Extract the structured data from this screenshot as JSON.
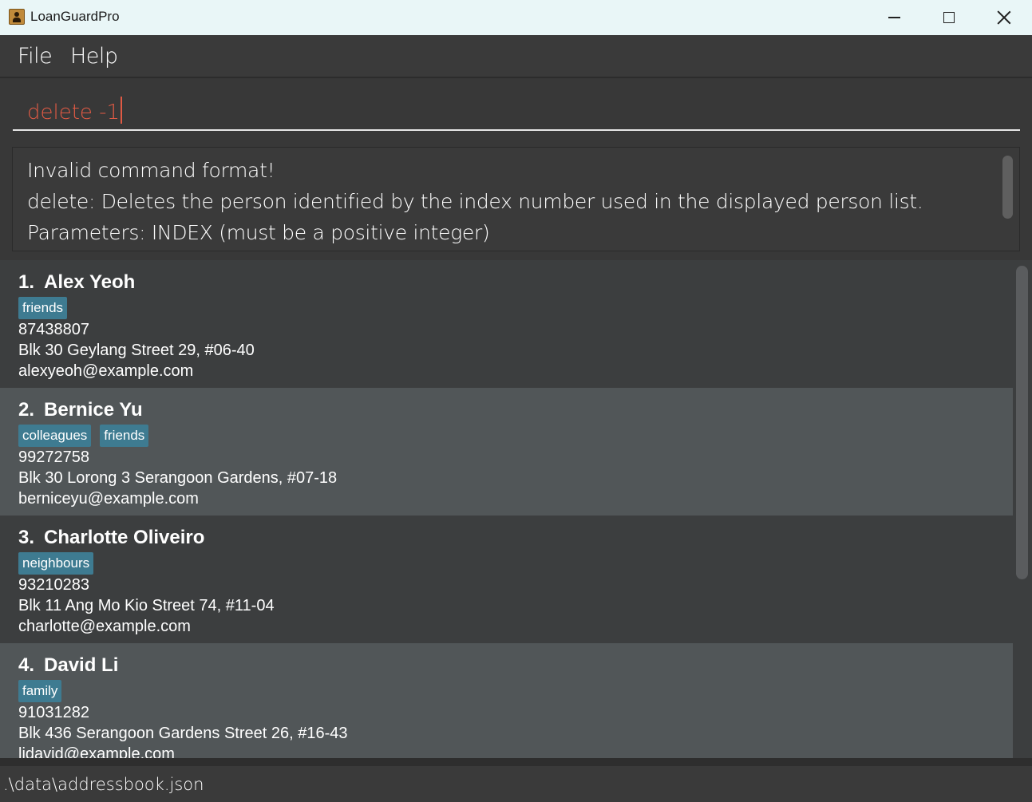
{
  "window": {
    "title": "LoanGuardPro",
    "icon": "contact-book-icon",
    "controls": [
      "minimize-icon",
      "maximize-icon",
      "close-icon"
    ]
  },
  "menu": {
    "items": [
      {
        "label": "File"
      },
      {
        "label": "Help"
      }
    ]
  },
  "command": {
    "value": "delete -1",
    "text_color": "#e05a44"
  },
  "result": {
    "lines": [
      "Invalid command format!",
      "delete: Deletes the person identified by the index number used in the displayed person list.",
      "Parameters: INDEX (must be a positive integer)"
    ]
  },
  "persons": [
    {
      "index": "1.",
      "name": "Alex Yeoh",
      "tags": [
        "friends"
      ],
      "phone": "87438807",
      "address": "Blk 30 Geylang Street 29, #06-40",
      "email": "alexyeoh@example.com"
    },
    {
      "index": "2.",
      "name": "Bernice Yu",
      "tags": [
        "colleagues",
        "friends"
      ],
      "phone": "99272758",
      "address": "Blk 30 Lorong 3 Serangoon Gardens, #07-18",
      "email": "berniceyu@example.com"
    },
    {
      "index": "3.",
      "name": "Charlotte Oliveiro",
      "tags": [
        "neighbours"
      ],
      "phone": "93210283",
      "address": "Blk 11 Ang Mo Kio Street 74, #11-04",
      "email": "charlotte@example.com"
    },
    {
      "index": "4.",
      "name": "David Li",
      "tags": [
        "family"
      ],
      "phone": "91031282",
      "address": "Blk 436 Serangoon Gardens Street 26, #16-43",
      "email": "lidavid@example.com"
    }
  ],
  "status": {
    "file_path": ".\\data\\addressbook.json"
  },
  "colors": {
    "tag_background": "#3e7b91",
    "card_alt_background": "#515658",
    "card_background": "#3c3e3f"
  }
}
